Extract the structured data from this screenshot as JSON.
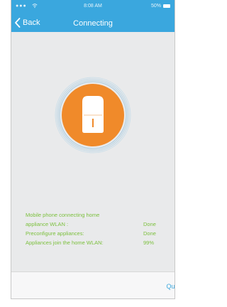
{
  "status_bar": {
    "signal": "●●●",
    "time": "8:08 AM",
    "battery": "50%"
  },
  "nav": {
    "back_label": "Back",
    "title": "Connecting"
  },
  "progress": {
    "lines": [
      {
        "label": "Mobile phone connecting home",
        "value": ""
      },
      {
        "label": "appliance WLAN :",
        "value": "Done"
      },
      {
        "label": "Preconfigure appliances:",
        "value": "Done"
      },
      {
        "label": "Appliances join the home WLAN:",
        "value": "99%"
      }
    ]
  },
  "footer": {
    "quit_label": "Quit"
  },
  "colors": {
    "header": "#3aa7de",
    "accent_orange": "#f08a2a",
    "status_green": "#7cc03e",
    "background": "#e9eaeb"
  },
  "icons": [
    "wifi-icon",
    "battery-icon",
    "chevron-left-icon",
    "appliance-icon"
  ]
}
